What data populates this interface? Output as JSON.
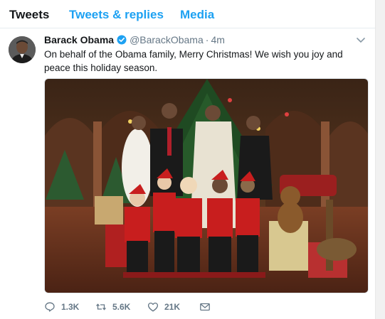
{
  "tabs": [
    {
      "label": "Tweets"
    },
    {
      "label": "Tweets & replies"
    },
    {
      "label": "Media"
    }
  ],
  "tweet": {
    "name": "Barack Obama",
    "handle": "@BarackObama",
    "separator": "·",
    "time": "4m",
    "text": "On behalf of the Obama family, Merry Christmas! We wish you joy and peace this holiday season.",
    "verified": true,
    "media": {
      "type": "photo",
      "icon": "photo-image"
    },
    "actions": {
      "replies": "1.3K",
      "retweets": "5.6K",
      "likes": "21K"
    }
  },
  "colors": {
    "accent": "#1da1f2",
    "text": "#14171a",
    "secondary": "#657786",
    "border": "#e6ecf0"
  }
}
